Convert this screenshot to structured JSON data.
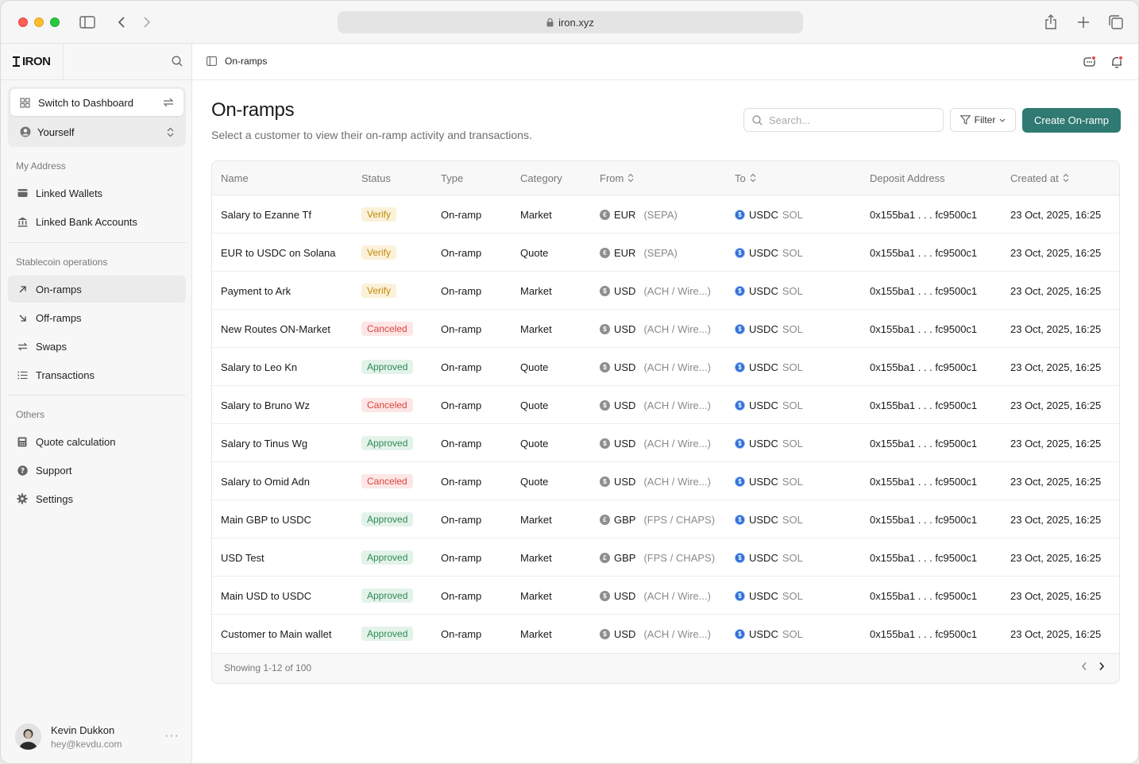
{
  "browser": {
    "url": "iron.xyz"
  },
  "sidebar": {
    "brand": "IRON",
    "switch_label": "Switch to Dashboard",
    "account_label": "Yourself",
    "sections": {
      "my_address": "My Address",
      "stablecoin_ops": "Stablecoin operations",
      "others": "Others"
    },
    "items": {
      "linked_wallets": "Linked Wallets",
      "linked_bank": "Linked Bank Accounts",
      "on_ramps": "On-ramps",
      "off_ramps": "Off-ramps",
      "swaps": "Swaps",
      "transactions": "Transactions",
      "quote_calc": "Quote calculation",
      "support": "Support",
      "settings": "Settings"
    },
    "user": {
      "name": "Kevin Dukkon",
      "email": "hey@kevdu.com"
    }
  },
  "header": {
    "breadcrumb": "On-ramps"
  },
  "page": {
    "title": "On-ramps",
    "subtitle": "Select a customer to view their on-ramp activity and transactions.",
    "search_placeholder": "Search...",
    "filter_label": "Filter",
    "create_label": "Create On-ramp"
  },
  "table": {
    "columns": {
      "name": "Name",
      "status": "Status",
      "type": "Type",
      "category": "Category",
      "from": "From",
      "to": "To",
      "deposit": "Deposit Address",
      "created": "Created at"
    },
    "rows": [
      {
        "name": "Salary to Ezanne Tf",
        "status": "Verify",
        "type": "On-ramp",
        "category": "Market",
        "from_cur": "EUR",
        "from_rail": "(SEPA)",
        "to_cur": "USDC",
        "to_chain": "SOL",
        "deposit": "0x155ba1 . . . fc9500c1",
        "created": "23 Oct, 2025, 16:25"
      },
      {
        "name": "EUR to USDC on Solana",
        "status": "Verify",
        "type": "On-ramp",
        "category": "Quote",
        "from_cur": "EUR",
        "from_rail": "(SEPA)",
        "to_cur": "USDC",
        "to_chain": "SOL",
        "deposit": "0x155ba1 . . . fc9500c1",
        "created": "23 Oct, 2025, 16:25"
      },
      {
        "name": "Payment to Ark",
        "status": "Verify",
        "type": "On-ramp",
        "category": "Market",
        "from_cur": "USD",
        "from_rail": "(ACH / Wire...)",
        "to_cur": "USDC",
        "to_chain": "SOL",
        "deposit": "0x155ba1 . . . fc9500c1",
        "created": "23 Oct, 2025, 16:25"
      },
      {
        "name": "New Routes ON-Market",
        "status": "Canceled",
        "type": "On-ramp",
        "category": "Market",
        "from_cur": "USD",
        "from_rail": "(ACH / Wire...)",
        "to_cur": "USDC",
        "to_chain": "SOL",
        "deposit": "0x155ba1 . . . fc9500c1",
        "created": "23 Oct, 2025, 16:25"
      },
      {
        "name": "Salary to Leo Kn",
        "status": "Approved",
        "type": "On-ramp",
        "category": "Quote",
        "from_cur": "USD",
        "from_rail": "(ACH / Wire...)",
        "to_cur": "USDC",
        "to_chain": "SOL",
        "deposit": "0x155ba1 . . . fc9500c1",
        "created": "23 Oct, 2025, 16:25"
      },
      {
        "name": "Salary to Bruno Wz",
        "status": "Canceled",
        "type": "On-ramp",
        "category": "Quote",
        "from_cur": "USD",
        "from_rail": "(ACH / Wire...)",
        "to_cur": "USDC",
        "to_chain": "SOL",
        "deposit": "0x155ba1 . . . fc9500c1",
        "created": "23 Oct, 2025, 16:25"
      },
      {
        "name": "Salary to Tinus Wg",
        "status": "Approved",
        "type": "On-ramp",
        "category": "Quote",
        "from_cur": "USD",
        "from_rail": "(ACH / Wire...)",
        "to_cur": "USDC",
        "to_chain": "SOL",
        "deposit": "0x155ba1 . . . fc9500c1",
        "created": "23 Oct, 2025, 16:25"
      },
      {
        "name": "Salary to Omid Adn",
        "status": "Canceled",
        "type": "On-ramp",
        "category": "Quote",
        "from_cur": "USD",
        "from_rail": "(ACH / Wire...)",
        "to_cur": "USDC",
        "to_chain": "SOL",
        "deposit": "0x155ba1 . . . fc9500c1",
        "created": "23 Oct, 2025, 16:25"
      },
      {
        "name": "Main GBP to USDC",
        "status": "Approved",
        "type": "On-ramp",
        "category": "Market",
        "from_cur": "GBP",
        "from_rail": "(FPS / CHAPS)",
        "to_cur": "USDC",
        "to_chain": "SOL",
        "deposit": "0x155ba1 . . . fc9500c1",
        "created": "23 Oct, 2025, 16:25"
      },
      {
        "name": "USD Test",
        "status": "Approved",
        "type": "On-ramp",
        "category": "Market",
        "from_cur": "GBP",
        "from_rail": "(FPS / CHAPS)",
        "to_cur": "USDC",
        "to_chain": "SOL",
        "deposit": "0x155ba1 . . . fc9500c1",
        "created": "23 Oct, 2025, 16:25"
      },
      {
        "name": "Main USD to USDC",
        "status": "Approved",
        "type": "On-ramp",
        "category": "Market",
        "from_cur": "USD",
        "from_rail": "(ACH / Wire...)",
        "to_cur": "USDC",
        "to_chain": "SOL",
        "deposit": "0x155ba1 . . . fc9500c1",
        "created": "23 Oct, 2025, 16:25"
      },
      {
        "name": "Customer to Main wallet",
        "status": "Approved",
        "type": "On-ramp",
        "category": "Market",
        "from_cur": "USD",
        "from_rail": "(ACH / Wire...)",
        "to_cur": "USDC",
        "to_chain": "SOL",
        "deposit": "0x155ba1 . . . fc9500c1",
        "created": "23 Oct, 2025, 16:25"
      }
    ],
    "footer": "Showing 1-12 of 100"
  },
  "colors": {
    "accent": "#2f7a72",
    "verify": "#c08a0a",
    "canceled": "#d9453d",
    "approved": "#2c8a55"
  }
}
